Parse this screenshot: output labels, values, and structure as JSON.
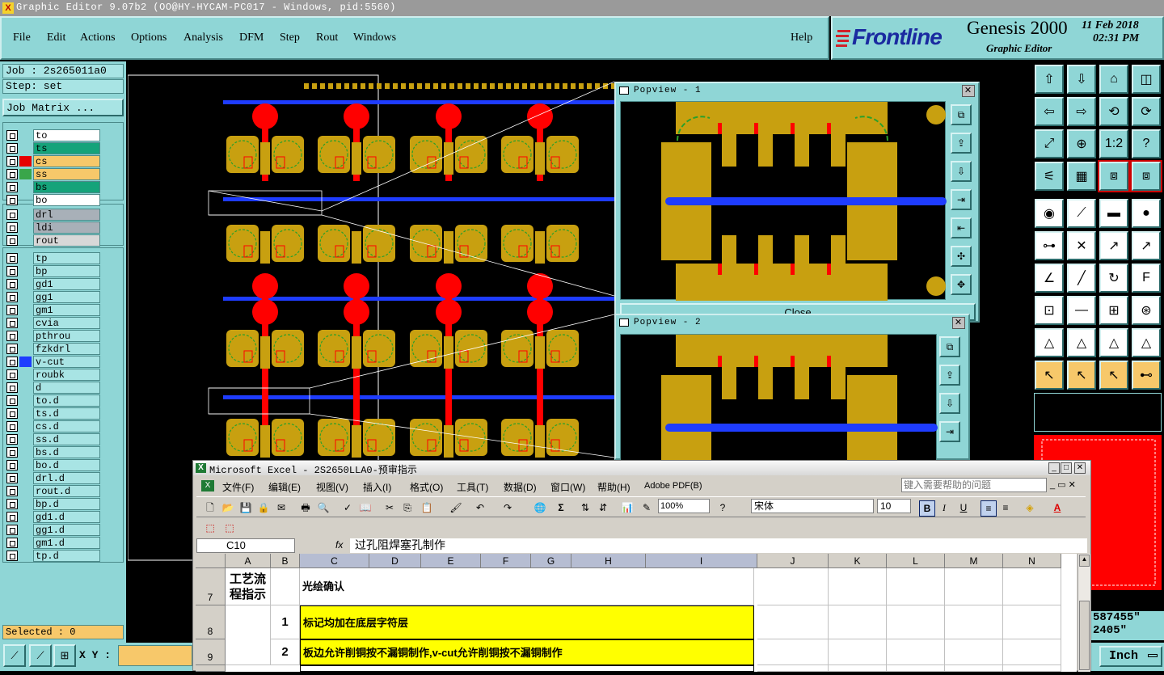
{
  "window": {
    "title": "Graphic Editor 9.07b2 (OO@HY-HYCAM-PC017 - Windows, pid:5560)"
  },
  "menu": [
    "File",
    "Edit",
    "Actions",
    "Options",
    "Analysis",
    "DFM",
    "Step",
    "Rout",
    "Windows"
  ],
  "help": "Help",
  "brand": {
    "logo": "Frontline",
    "product": "Genesis 2000",
    "subtitle": "Graphic Editor",
    "date": "11 Feb 2018",
    "time": "02:31 PM"
  },
  "job": {
    "label": "Job : 2s265011a0",
    "step": "Step: set",
    "matrix_button": "Job Matrix ..."
  },
  "layers": {
    "group1": [
      {
        "name": "to",
        "bg": "#ffffff",
        "swatch": ""
      },
      {
        "name": "ts",
        "bg": "#15a37a",
        "swatch": ""
      },
      {
        "name": "cs",
        "bg": "#f7c86a",
        "swatch": "#e60000"
      },
      {
        "name": "ss",
        "bg": "#f7c86a",
        "swatch": "#3aa64a"
      },
      {
        "name": "bs",
        "bg": "#15a37a",
        "swatch": ""
      },
      {
        "name": "bo",
        "bg": "#ffffff",
        "swatch": ""
      }
    ],
    "group2": [
      {
        "name": "drl",
        "bg": "#a8b0b8",
        "swatch": ""
      },
      {
        "name": "ldi",
        "bg": "#a8b0b8",
        "swatch": ""
      },
      {
        "name": "rout",
        "bg": "#d8d8d8",
        "swatch": ""
      }
    ],
    "group3": [
      {
        "name": "tp",
        "bg": "#a8e4e4",
        "swatch": ""
      },
      {
        "name": "bp",
        "bg": "#a8e4e4",
        "swatch": ""
      },
      {
        "name": "gd1",
        "bg": "#a8e4e4",
        "swatch": ""
      },
      {
        "name": "gg1",
        "bg": "#a8e4e4",
        "swatch": ""
      },
      {
        "name": "gm1",
        "bg": "#a8e4e4",
        "swatch": ""
      },
      {
        "name": "cvia",
        "bg": "#a8e4e4",
        "swatch": ""
      },
      {
        "name": "pthrou",
        "bg": "#a8e4e4",
        "swatch": ""
      },
      {
        "name": "fzkdrl",
        "bg": "#a8e4e4",
        "swatch": ""
      },
      {
        "name": "v-cut",
        "bg": "#a8e4e4",
        "swatch": "#1e3cff"
      },
      {
        "name": "roubk",
        "bg": "#a8e4e4",
        "swatch": ""
      },
      {
        "name": "d",
        "bg": "#a8e4e4",
        "swatch": ""
      },
      {
        "name": "to.d",
        "bg": "#a8e4e4",
        "swatch": ""
      },
      {
        "name": "ts.d",
        "bg": "#a8e4e4",
        "swatch": ""
      },
      {
        "name": "cs.d",
        "bg": "#a8e4e4",
        "swatch": ""
      },
      {
        "name": "ss.d",
        "bg": "#a8e4e4",
        "swatch": ""
      },
      {
        "name": "bs.d",
        "bg": "#a8e4e4",
        "swatch": ""
      },
      {
        "name": "bo.d",
        "bg": "#a8e4e4",
        "swatch": ""
      },
      {
        "name": "drl.d",
        "bg": "#a8e4e4",
        "swatch": ""
      },
      {
        "name": "rout.d",
        "bg": "#a8e4e4",
        "swatch": ""
      },
      {
        "name": "bp.d",
        "bg": "#a8e4e4",
        "swatch": ""
      },
      {
        "name": "gd1.d",
        "bg": "#a8e4e4",
        "swatch": ""
      },
      {
        "name": "gg1.d",
        "bg": "#a8e4e4",
        "swatch": ""
      },
      {
        "name": "gm1.d",
        "bg": "#a8e4e4",
        "swatch": ""
      },
      {
        "name": "tp.d",
        "bg": "#a8e4e4",
        "swatch": ""
      }
    ]
  },
  "status": {
    "selected": "Selected : 0",
    "xy_label": "X Y :",
    "units": "Inch",
    "coord1": "587455\"",
    "coord2": "2405\""
  },
  "popview1": {
    "title": "Popview - 1",
    "close": "Close"
  },
  "popview2": {
    "title": "Popview - 2"
  },
  "excel": {
    "title": "Microsoft Excel - 2S2650LLA0-预审指示",
    "menu": [
      "文件(F)",
      "编辑(E)",
      "视图(V)",
      "插入(I)",
      "格式(O)",
      "工具(T)",
      "数据(D)",
      "窗口(W)",
      "帮助(H)",
      "Adobe PDF(B)"
    ],
    "help_placeholder": "键入需要帮助的问题",
    "zoom": "100%",
    "font": "宋体",
    "font_size": "10",
    "name_box": "C10",
    "formula": "过孔阻焊塞孔制作",
    "columns": [
      "A",
      "B",
      "C",
      "D",
      "E",
      "F",
      "G",
      "H",
      "I",
      "J",
      "K",
      "L",
      "M",
      "N"
    ],
    "rows": [
      {
        "num": "7",
        "a": "工艺流程指示",
        "b": "",
        "c": "光绘确认"
      },
      {
        "num": "8",
        "a": "",
        "b": "1",
        "c": "标记均加在底层字符层"
      },
      {
        "num": "9",
        "a": "",
        "b": "2",
        "c": "板边允许削铜按不漏铜制作,v-cut允许削铜按不漏铜制作"
      }
    ]
  },
  "colors": {
    "panel": "#8fd6d6",
    "pad": "#c8a010",
    "red": "#ff0000",
    "blue": "#1e3cff"
  }
}
